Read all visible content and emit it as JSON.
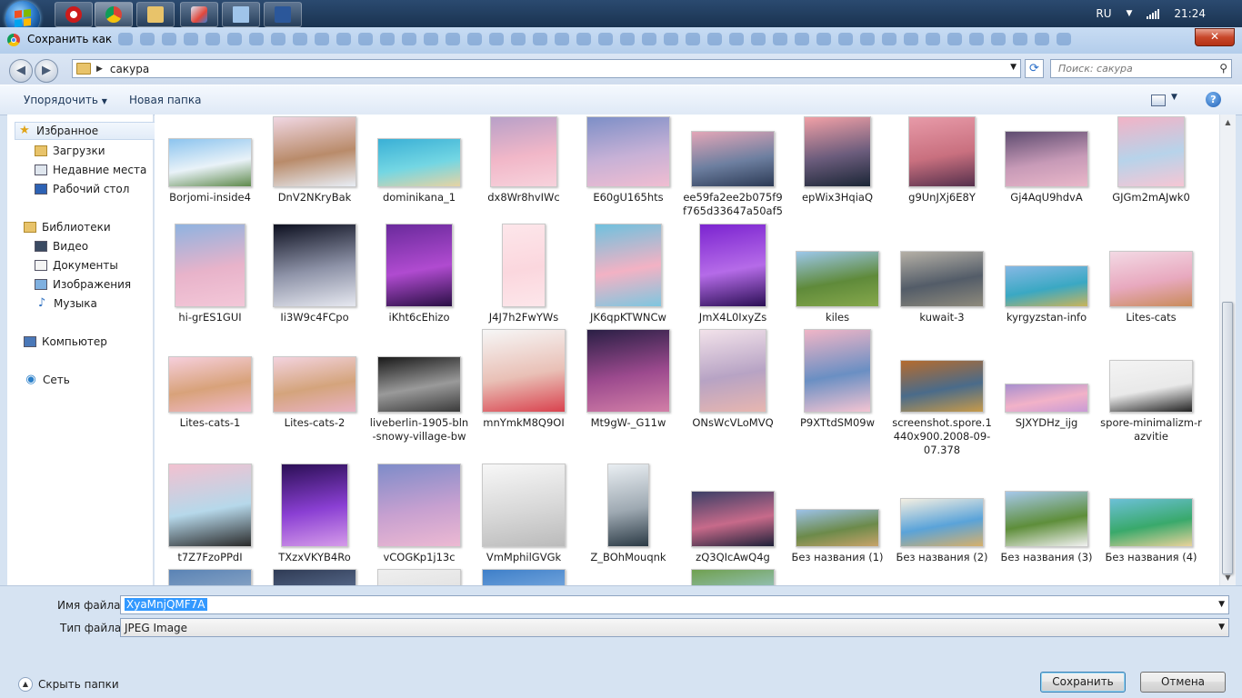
{
  "taskbar": {
    "apps": [
      {
        "icon": "opera-icon",
        "color": "#cc1b1b"
      },
      {
        "icon": "chrome-icon",
        "color": "#4285f4"
      },
      {
        "icon": "explorer-icon",
        "color": "#e8c36a"
      },
      {
        "icon": "paint-icon",
        "color": "#d9e6f5"
      },
      {
        "icon": "notepad-icon",
        "color": "#9fc4ea"
      },
      {
        "icon": "word-icon",
        "color": "#2b579a"
      }
    ],
    "language": "RU",
    "clock": "21:24"
  },
  "dialog": {
    "title": "Сохранить как",
    "close_label": "✕",
    "address_path": "сакура",
    "search_placeholder": "Поиск: сакура",
    "toolbar": {
      "organize": "Упорядочить",
      "new_folder": "Новая папка"
    }
  },
  "nav": {
    "favorites": "Избранное",
    "downloads": "Загрузки",
    "recent": "Недавние места",
    "desktop": "Рабочий стол",
    "libraries": "Библиотеки",
    "video": "Видео",
    "documents": "Документы",
    "images": "Изображения",
    "music": "Музыка",
    "computer": "Компьютер",
    "network": "Сеть"
  },
  "files": [
    {
      "name": "Borjomi-inside4",
      "colors": [
        "#8cc4ef",
        "#e9f2f8",
        "#5f8a4c"
      ]
    },
    {
      "name": "DnV2NKryBak",
      "colors": [
        "#f0d7e3",
        "#b98b6a",
        "#e8eef6"
      ]
    },
    {
      "name": "dominikana_1",
      "colors": [
        "#3ab0d6",
        "#73d6e3",
        "#e6d3a3"
      ]
    },
    {
      "name": "dx8Wr8hvIWc",
      "colors": [
        "#b8a0c8",
        "#f1b7c8",
        "#f7d2dc"
      ]
    },
    {
      "name": "E60gU165hts",
      "colors": [
        "#7d8fc7",
        "#c7b1d6",
        "#f0bdd1"
      ]
    },
    {
      "name": "ee59fa2ee2b075f9f765d33647a50af5",
      "colors": [
        "#e3a6b7",
        "#6d7fa0",
        "#2c3a55"
      ]
    },
    {
      "name": "epWix3HqiaQ",
      "colors": [
        "#f1a0a6",
        "#6b5c7c",
        "#1b2636"
      ]
    },
    {
      "name": "g9UnJXj6E8Y",
      "colors": [
        "#e79aa8",
        "#c9707f",
        "#55304c"
      ]
    },
    {
      "name": "Gj4AqU9hdvA",
      "colors": [
        "#5e4c70",
        "#c79ab7",
        "#e9b7c9"
      ]
    },
    {
      "name": "GJGm2mAJwk0",
      "colors": [
        "#f2b3c6",
        "#b7d3ea",
        "#f6c6d4"
      ]
    },
    {
      "name": "hi-grES1GUI",
      "colors": [
        "#8fb3e0",
        "#e8b3ca",
        "#f3c7d8"
      ]
    },
    {
      "name": "Ii3W9c4FCpo",
      "colors": [
        "#0d1020",
        "#8e93a8",
        "#e6e8f0"
      ]
    },
    {
      "name": "iKht6cEhizo",
      "colors": [
        "#6a2a9c",
        "#b04bd0",
        "#2a0f45"
      ]
    },
    {
      "name": "J4J7h2FwYWs",
      "colors": [
        "#fde6ea",
        "#fbd7de",
        "#fde6ea"
      ]
    },
    {
      "name": "JK6qpKTWNCw",
      "colors": [
        "#6fc1de",
        "#f3b2c4",
        "#7ec6df"
      ]
    },
    {
      "name": "JmX4L0IxyZs",
      "colors": [
        "#7b24d0",
        "#b56be8",
        "#2b0f55"
      ]
    },
    {
      "name": "kiles",
      "colors": [
        "#9cc7ea",
        "#5f8a3a",
        "#86a84c"
      ]
    },
    {
      "name": "kuwait-3",
      "colors": [
        "#b5b0a6",
        "#535c68",
        "#8e8a7c"
      ]
    },
    {
      "name": "kyrgyzstan-info",
      "colors": [
        "#86b8e4",
        "#3aa8c3",
        "#c9b45a"
      ]
    },
    {
      "name": "Lites-cats",
      "colors": [
        "#f3d9e4",
        "#e8a9bf",
        "#c98b5a"
      ]
    },
    {
      "name": "Lites-cats-1",
      "colors": [
        "#f6cfdc",
        "#d8a27a",
        "#f0b9c9"
      ]
    },
    {
      "name": "Lites-cats-2",
      "colors": [
        "#f3d3df",
        "#d4a47c",
        "#e9b2c3"
      ]
    },
    {
      "name": "liveberlin-1905-bln-snowy-village-bw",
      "colors": [
        "#1a1a1a",
        "#9a9a9a",
        "#3a3a3a"
      ]
    },
    {
      "name": "mnYmkM8Q9OI",
      "colors": [
        "#f6f6f6",
        "#e9c0b6",
        "#d9424e"
      ]
    },
    {
      "name": "Mt9gW-_G11w",
      "colors": [
        "#2a1f45",
        "#9c4a8e",
        "#d27fa7"
      ]
    },
    {
      "name": "ONsWcVLoMVQ",
      "colors": [
        "#f2e2ea",
        "#b7a3c4",
        "#e7b6b0"
      ]
    },
    {
      "name": "P9XTtdSM09w",
      "colors": [
        "#f0b5c6",
        "#6a8fc3",
        "#f4c4d2"
      ]
    },
    {
      "name": "screenshot.spore.1440x900.2008-09-07.378",
      "colors": [
        "#b56b2e",
        "#4a6b8a",
        "#c79a4a"
      ]
    },
    {
      "name": "SJXYDHz_ijg",
      "colors": [
        "#a88fcf",
        "#f2b2c8",
        "#c89bd5"
      ]
    },
    {
      "name": "spore-minimalizm-razvitie",
      "colors": [
        "#f4f4f4",
        "#e9e9e9",
        "#222222"
      ]
    },
    {
      "name": "t7Z7FzoPPdI",
      "colors": [
        "#f2c1d0",
        "#b6d8ea",
        "#2a2a2a"
      ]
    },
    {
      "name": "TXzxVKYB4Ro",
      "colors": [
        "#2b0f55",
        "#8a3fd3",
        "#d59be9"
      ]
    },
    {
      "name": "vCOGKp1j13c",
      "colors": [
        "#7e8cc9",
        "#c7a0d0",
        "#ecb9d2"
      ]
    },
    {
      "name": "VmMphilGVGk",
      "colors": [
        "#f7f7f7",
        "#d8d8d8",
        "#bbbbbb"
      ]
    },
    {
      "name": "Z_BOhMouqnk",
      "colors": [
        "#e9eef2",
        "#9ea9b2",
        "#2b3a45"
      ]
    },
    {
      "name": "zQ3QIcAwQ4g",
      "colors": [
        "#3b3f66",
        "#c76a8a",
        "#1e2139"
      ]
    },
    {
      "name": "Без названия (1)",
      "colors": [
        "#9cc2e8",
        "#6c8a4a",
        "#c8a36a"
      ]
    },
    {
      "name": "Без названия (2)",
      "colors": [
        "#f4efe2",
        "#5aa3d9",
        "#d7b06a"
      ]
    },
    {
      "name": "Без названия (3)",
      "colors": [
        "#a6c8ea",
        "#5e8e3a",
        "#f2f2f2"
      ]
    },
    {
      "name": "Без названия (4)",
      "colors": [
        "#6cc0d8",
        "#39a96b",
        "#e9d29a"
      ]
    }
  ],
  "partial_files": [
    {
      "colors": [
        "#5a83b5",
        "#9db3cc"
      ]
    },
    {
      "colors": [
        "#2f3b55",
        "#6a7fa3"
      ]
    },
    {
      "colors": [
        "#efefef",
        "#dcdcdc"
      ]
    },
    {
      "colors": [
        "#3e7fc9",
        "#8fb9e6"
      ]
    },
    {
      "colors": [
        "#6fa04f",
        "#a8d2ef"
      ]
    }
  ],
  "form": {
    "filename_label": "Имя файла:",
    "filename_value": "XyaMnjQMF7A",
    "filetype_label": "Тип файла:",
    "filetype_value": "JPEG Image",
    "hide_folders": "Скрыть папки",
    "save": "Сохранить",
    "cancel": "Отмена"
  }
}
